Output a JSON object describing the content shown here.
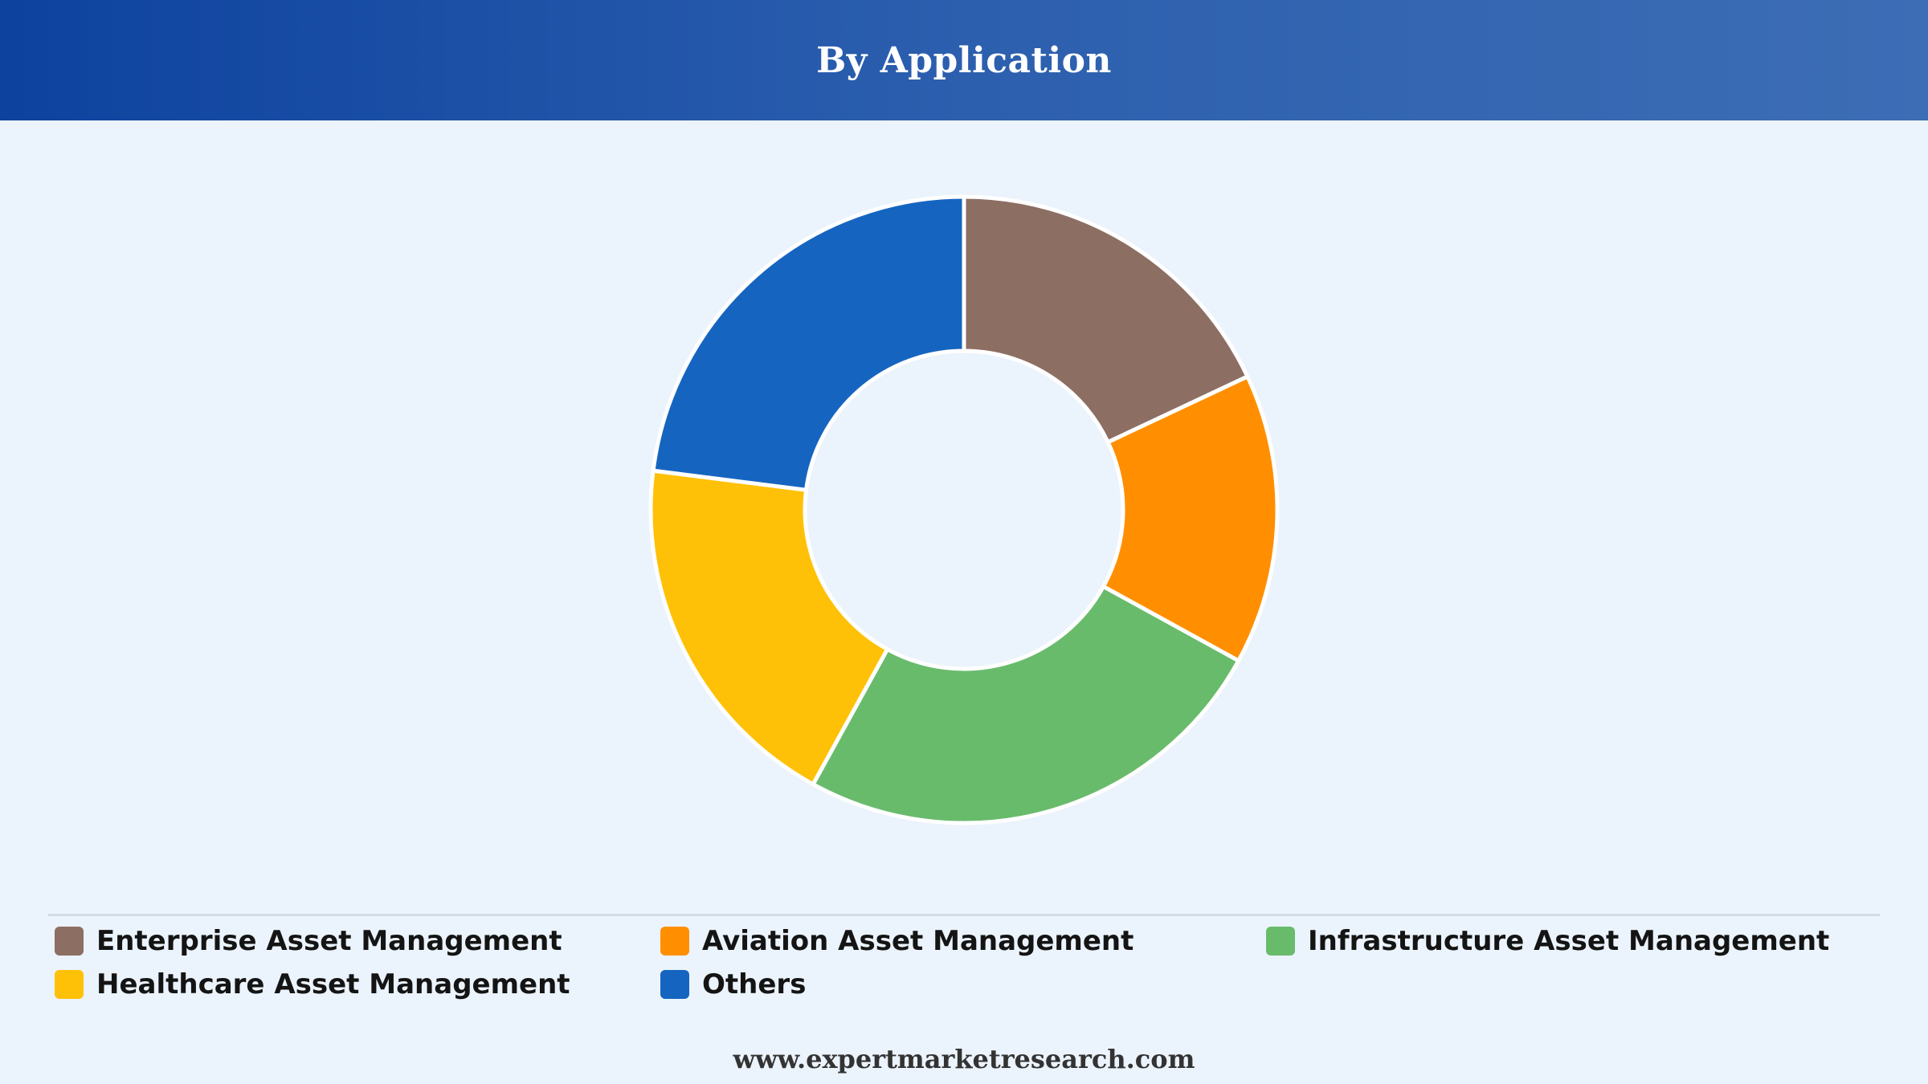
{
  "header": {
    "title": "By Application"
  },
  "chart_data": {
    "type": "pie",
    "title": "By Application",
    "donut": true,
    "categories": [
      "Enterprise Asset Management",
      "Aviation Asset Management",
      "Infrastructure Asset Management",
      "Healthcare Asset Management",
      "Others"
    ],
    "values": [
      18,
      15,
      25,
      19,
      23
    ],
    "colors": [
      "#8d6e63",
      "#ff8f00",
      "#69bb6c",
      "#ffc107",
      "#1565c0"
    ],
    "legend_position": "bottom",
    "grid": false
  },
  "footer": {
    "website": "www.expertmarketresearch.com"
  }
}
